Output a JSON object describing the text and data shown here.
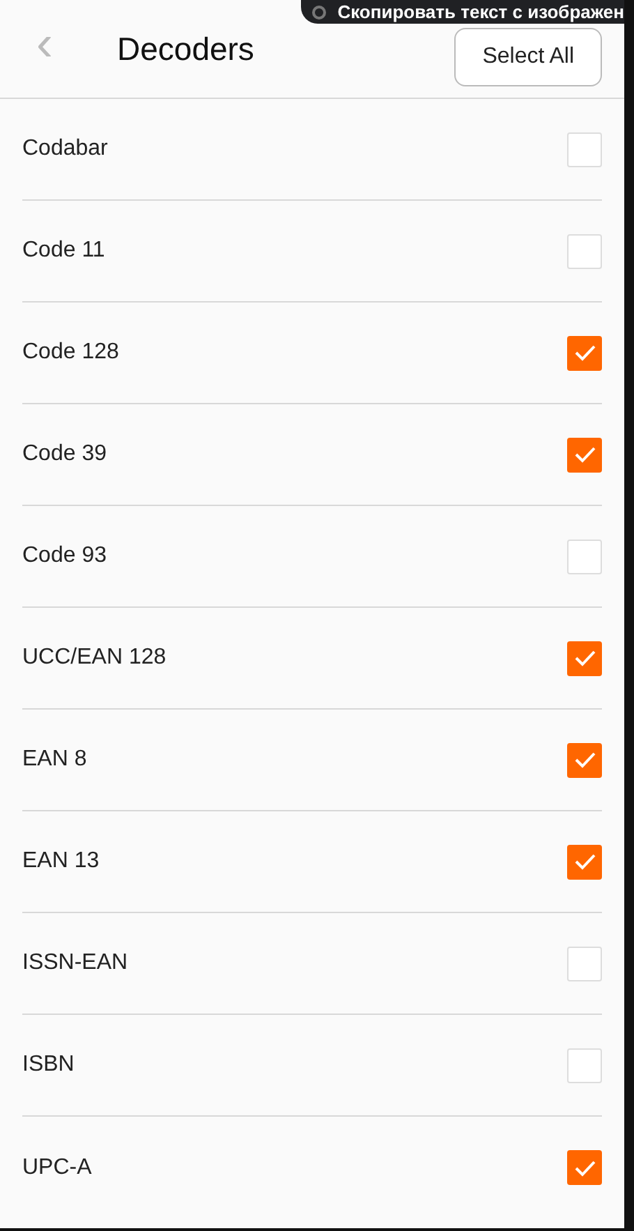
{
  "toast": {
    "text": "Скопировать текст с изображен"
  },
  "header": {
    "back": "‹",
    "title": "Decoders",
    "action": "Select All"
  },
  "decoders": [
    {
      "name": "Codabar",
      "checked": false
    },
    {
      "name": "Code 11",
      "checked": false
    },
    {
      "name": "Code 128",
      "checked": true
    },
    {
      "name": "Code 39",
      "checked": true
    },
    {
      "name": "Code 93",
      "checked": false
    },
    {
      "name": "UCC/EAN 128",
      "checked": true
    },
    {
      "name": "EAN 8",
      "checked": true
    },
    {
      "name": "EAN 13",
      "checked": true
    },
    {
      "name": "ISSN-EAN",
      "checked": false
    },
    {
      "name": "ISBN",
      "checked": false
    },
    {
      "name": "UPC-A",
      "checked": true
    }
  ]
}
